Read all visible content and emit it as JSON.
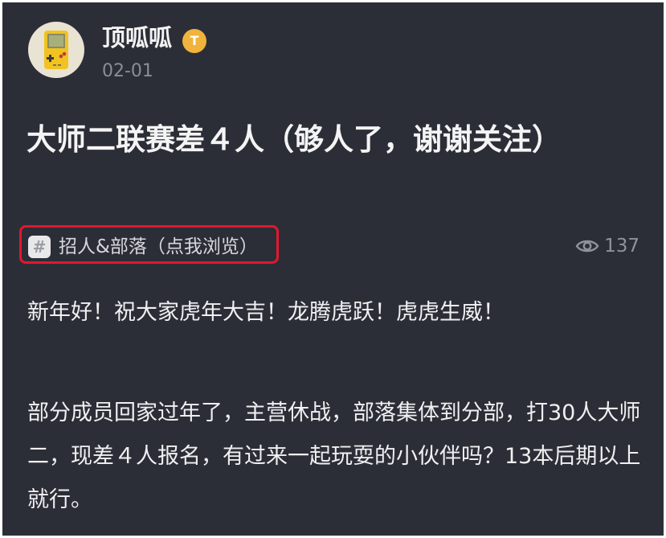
{
  "author": {
    "name": "顶呱呱",
    "badge": "T",
    "date": "02-01"
  },
  "post": {
    "title": "大师二联赛差４人（够人了，谢谢关注）",
    "tag": "招人&部落（点我浏览）",
    "views": "137",
    "paragraph1": "新年好！祝大家虎年大吉！龙腾虎跃！虎虎生威！",
    "paragraph2": "部分成员回家过年了，主营休战，部落集体到分部，打30人大师二，现差４人报名，有过来一起玩耍的小伙伴吗？13本后期以上就行。"
  },
  "icons": {
    "avatar": "gameboy-avatar",
    "badge": "level-badge-icon",
    "tag": "hash-icon",
    "views": "eye-icon"
  },
  "colors": {
    "background": "#2c2e37",
    "highlight": "#e3172e",
    "badge": "#f0b33b"
  }
}
